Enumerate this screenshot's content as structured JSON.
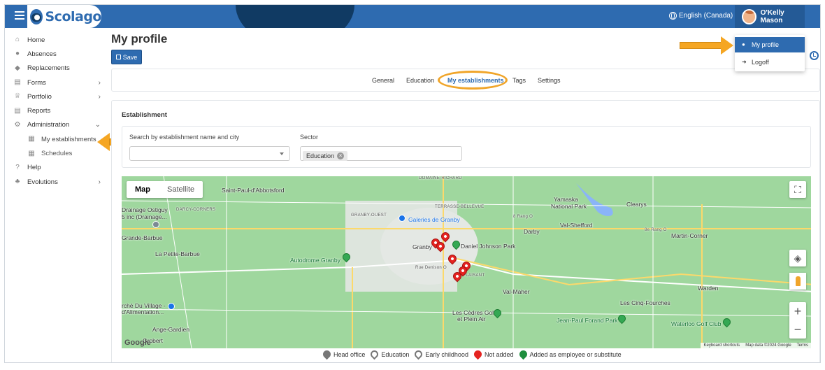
{
  "header": {
    "logo_text": "Scolago",
    "language": "English (Canada)",
    "user_name": "O'Kelly Mason"
  },
  "user_menu": {
    "items": [
      {
        "label": "My profile",
        "icon": "person-icon"
      },
      {
        "label": "Logoff",
        "icon": "logoff-icon"
      }
    ]
  },
  "sidebar": {
    "items": [
      {
        "label": "Home",
        "icon": "home-icon"
      },
      {
        "label": "Absences",
        "icon": "absences-icon"
      },
      {
        "label": "Replacements",
        "icon": "replacements-icon"
      },
      {
        "label": "Forms",
        "icon": "forms-icon"
      },
      {
        "label": "Portfolio",
        "icon": "trophy-icon"
      },
      {
        "label": "Reports",
        "icon": "reports-icon"
      },
      {
        "label": "Administration",
        "icon": "gear-icon"
      },
      {
        "label": "My establishments",
        "icon": "building-icon"
      },
      {
        "label": "Schedules",
        "icon": "calendar-icon"
      },
      {
        "label": "Help",
        "icon": "question-icon"
      },
      {
        "label": "Evolutions",
        "icon": "sprout-icon"
      }
    ]
  },
  "page": {
    "title": "My profile",
    "save_label": "Save"
  },
  "tabs": [
    "General",
    "Education",
    "My establishments",
    "Tags",
    "Settings"
  ],
  "active_tab": "My establishments",
  "establishment": {
    "title": "Establishment",
    "search_label": "Search by establishment name and city",
    "search_value": "",
    "sector_label": "Sector",
    "sector_chip": "Education"
  },
  "map": {
    "type_buttons": [
      "Map",
      "Satellite"
    ],
    "selected_type": "Map",
    "labels": {
      "saint_paul": "Saint-Paul-d'Abbotsford",
      "drainage_1": "Drainage Ostiguy",
      "drainage_2": "5 inc (Drainage...",
      "grande_barbue": "Grande-Barbue",
      "petite_barbue": "La Petite-Barbue",
      "autodrome": "Autodrome Granby",
      "granby": "Granby",
      "galeries": "Galeries de Granby",
      "daniel_johnson": "Daniel Johnson Park",
      "yamaska": "Yamaska",
      "yamaska2": "National Park",
      "clearys": "Clearys",
      "val_shefford": "Val-Shefford",
      "darby": "Darby",
      "martin_corner": "Martin-Corner",
      "val_maher": "Val-Maher",
      "warden": "Warden",
      "les_cinq": "Les Cinq-Fourches",
      "cedres_1": "Les Cèdres Golf",
      "cedres_2": "et Plein Air",
      "jean_paul": "Jean-Paul Forand Park",
      "waterloo": "Waterloo Golf Club",
      "marche_1": "rché Du Village -",
      "marche_2": "d'Alimentation...",
      "ange_gardien": "Ange-Gardien",
      "domaine_richard": "DOMAINE-RICHARD",
      "terrasse": "TERRASSE-BELLEVUE",
      "granby_ouest": "GRANBY-OUEST",
      "darcy": "DARCY-CORNERS",
      "plaisant": "PLAISANT",
      "rang": "8 Rang O",
      "rang2": "8e Rang O",
      "denison": "Rue Denison O",
      "bergerie": "Grobert"
    },
    "google_label": "Google",
    "attribution": [
      "Keyboard shortcuts",
      "Map data ©2024 Google",
      "Terms"
    ],
    "road_numbers": [
      "112",
      "112",
      "139",
      "241",
      "243",
      "243",
      "112",
      "241",
      "10"
    ]
  },
  "legend": [
    {
      "label": "Head office",
      "type": "grey"
    },
    {
      "label": "Education",
      "type": "edu"
    },
    {
      "label": "Early childhood",
      "type": "child"
    },
    {
      "label": "Not added",
      "type": "red"
    },
    {
      "label": "Added as employee or substitute",
      "type": "green"
    }
  ],
  "colors": {
    "primary": "#2e6bb0",
    "dark_wave": "#103a63",
    "highlight_arrow": "#f5a623",
    "map_green": "#9fd79e",
    "pin_red": "#e52320",
    "pin_green": "#1e8e3e"
  }
}
